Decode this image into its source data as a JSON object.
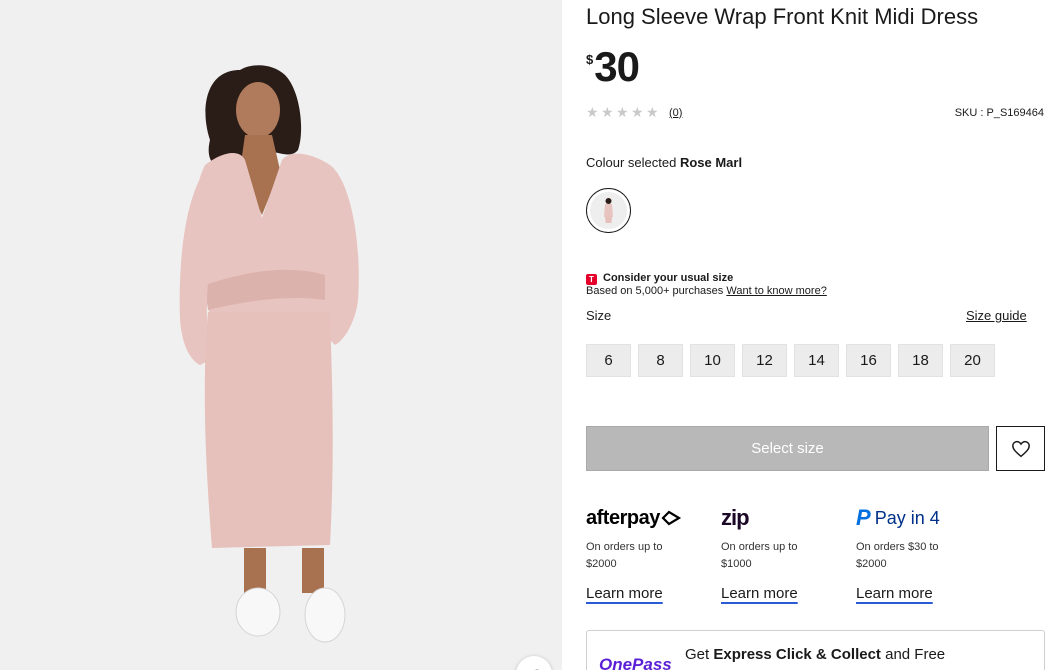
{
  "product": {
    "title": "Long Sleeve Wrap Front Knit Midi Dress",
    "currency_symbol": "$",
    "price": "30",
    "review_count": "(0)",
    "sku": "SKU : P_S169464",
    "rating_stars": 0
  },
  "colour": {
    "label": "Colour selected",
    "selected": "Rose Marl"
  },
  "size_advice": {
    "badge": "T",
    "heading": "Consider your usual size",
    "text": "Based on 5,000+ purchases",
    "link": "Want to know more?"
  },
  "size": {
    "label": "Size",
    "guide_link": "Size guide",
    "options": [
      "6",
      "8",
      "10",
      "12",
      "14",
      "16",
      "18",
      "20"
    ]
  },
  "actions": {
    "select_size": "Select size"
  },
  "payments": [
    {
      "name": "afterpay",
      "desc_line1": "On orders up to",
      "desc_line2": "$2000",
      "learn": "Learn more"
    },
    {
      "name": "zip",
      "desc_line1": "On orders up to",
      "desc_line2": "$1000",
      "learn": "Learn more"
    },
    {
      "name": "Pay in 4",
      "desc_line1": "On orders $30 to",
      "desc_line2": "$2000",
      "learn": "Learn more"
    }
  ],
  "onepass": {
    "logo": "OnePass",
    "text_prefix": "Get ",
    "text_bold": "Express Click & Collect",
    "text_suffix": " and Free"
  },
  "colors": {
    "dress": "#e8c4c0",
    "background": "#f0f0f0",
    "link_underline": "#2a5bd7",
    "onepass": "#5a1fd6"
  },
  "icons": {
    "zoom": "expand-arrow-icon",
    "wishlist": "heart-icon",
    "star": "star-icon"
  }
}
